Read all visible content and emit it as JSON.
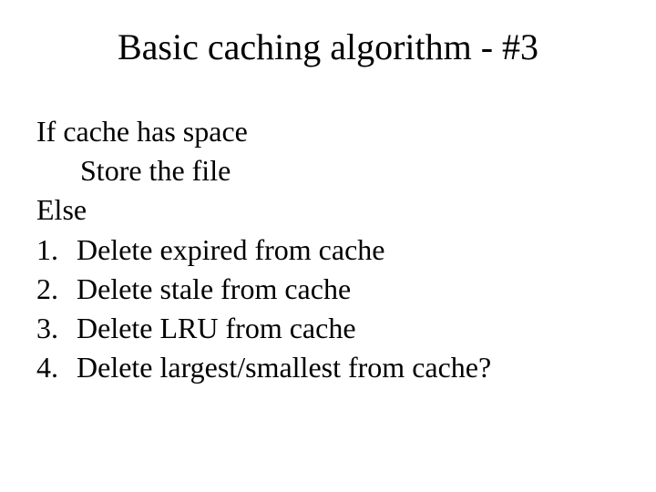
{
  "title": "Basic caching algorithm  - #3",
  "body": {
    "if_line": "If cache has space",
    "store_line": "Store the file",
    "else_line": "Else",
    "steps": [
      {
        "num": "1.",
        "text": "Delete expired from cache"
      },
      {
        "num": "2.",
        "text": "Delete stale from cache"
      },
      {
        "num": "3.",
        "text": "Delete LRU from cache"
      },
      {
        "num": "4.",
        "text": "Delete largest/smallest from cache?"
      }
    ]
  }
}
